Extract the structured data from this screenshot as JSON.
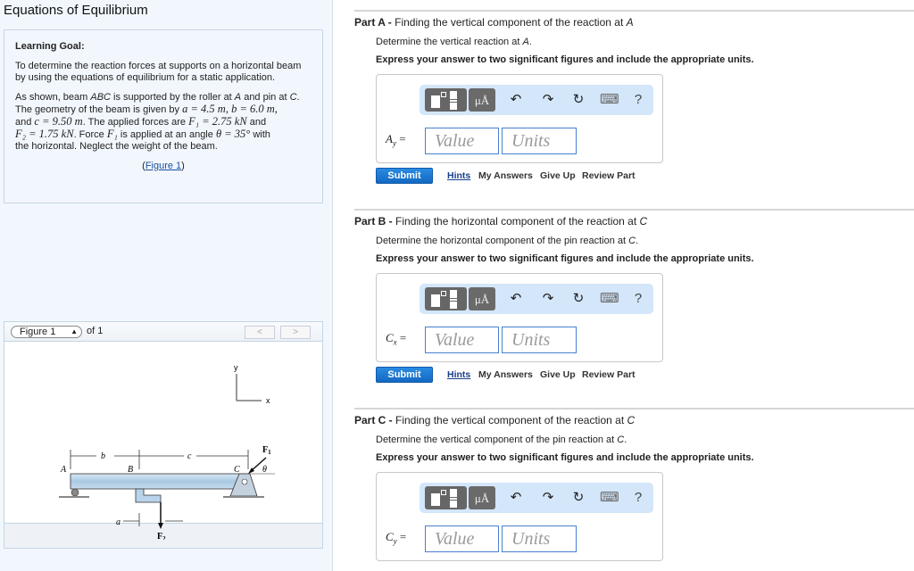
{
  "page_title": "Equations of Equilibrium",
  "learning_goal": {
    "heading": "Learning Goal:",
    "paragraph1": "To determine the reaction forces at supports on a horizontal beam by using the equations of equilibrium for a static application.",
    "p2_line1_a": "As shown, beam ",
    "p2_abc": "ABC",
    "p2_line1_b": " is supported by the roller at ",
    "p2_A": "A",
    "p2_line1_c": " and pin at ",
    "p2_C": "C",
    "p2_line1_d": ".",
    "p2_line2_a": "The geometry of the beam is given by ",
    "p2_a_eq": "a = 4.5 m, b = 6.0 m,",
    "p2_line3_a": "and ",
    "p2_c_eq": "c = 9.50 m",
    "p2_line3_b": ". The applied forces are ",
    "p2_F1_eq": "F₁ = 2.75 kN",
    "p2_line3_c": " and",
    "p2_F2_eq": "F₂ = 1.75 kN",
    "p2_line4_a": ". Force ",
    "p2_F1": "F₁",
    "p2_line4_b": " is applied at an angle ",
    "p2_theta_eq": "θ = 35°",
    "p2_line4_c": " with",
    "p2_line5": "the horizontal. Neglect the weight of the beam.",
    "figure_link_open": "(",
    "figure_link": "Figure 1",
    "figure_link_close": ")"
  },
  "figure_panel": {
    "selected": "Figure 1",
    "of_label": "of 1",
    "prev_label": "<",
    "next_label": ">",
    "diagram_labels": {
      "y_axis": "y",
      "x_axis": "x",
      "b": "b",
      "c": "c",
      "a": "a",
      "A": "A",
      "B": "B",
      "C": "C",
      "F1": "F",
      "F1_sub": "1",
      "F2": "F",
      "F2_sub": "2",
      "theta": "θ"
    }
  },
  "parts": [
    {
      "label": "Part A",
      "separator": " - ",
      "title_text": "Finding the vertical component of the reaction at ",
      "title_var": "A",
      "desc_text": "Determine the vertical reaction at ",
      "desc_var": "A",
      "desc_end": ".",
      "instruction": "Express your answer to two significant figures and include the appropriate units.",
      "eq_var": "A",
      "eq_sub": "y",
      "eq_sign": " =",
      "value_placeholder": "Value",
      "units_placeholder": "Units"
    },
    {
      "label": "Part B",
      "separator": " - ",
      "title_text": "Finding the horizontal component of the reaction at ",
      "title_var": "C",
      "desc_text": "Determine the horizontal component of the pin reaction at ",
      "desc_var": "C",
      "desc_end": ".",
      "instruction": "Express your answer to two significant figures and include the appropriate units.",
      "eq_var": "C",
      "eq_sub": "x",
      "eq_sign": " =",
      "value_placeholder": "Value",
      "units_placeholder": "Units"
    },
    {
      "label": "Part C",
      "separator": " - ",
      "title_text": "Finding the vertical component of the reaction at ",
      "title_var": "C",
      "desc_text": "Determine the vertical component of the pin reaction at ",
      "desc_var": "C",
      "desc_end": ".",
      "instruction": "Express your answer to two significant figures and include the appropriate units.",
      "eq_var": "C",
      "eq_sub": "y",
      "eq_sign": " =",
      "value_placeholder": "Value",
      "units_placeholder": "Units"
    }
  ],
  "toolbar": {
    "templates_icon": "templates-icon",
    "units_label": "μÅ",
    "undo_glyph": "↶",
    "redo_glyph": "↷",
    "reset_glyph": "↻",
    "keyboard_glyph": "⌨",
    "help_glyph": "?"
  },
  "actions": {
    "submit": "Submit",
    "hints": "Hints",
    "my_answers": "My Answers",
    "give_up": "Give Up",
    "review_part": "Review Part"
  }
}
